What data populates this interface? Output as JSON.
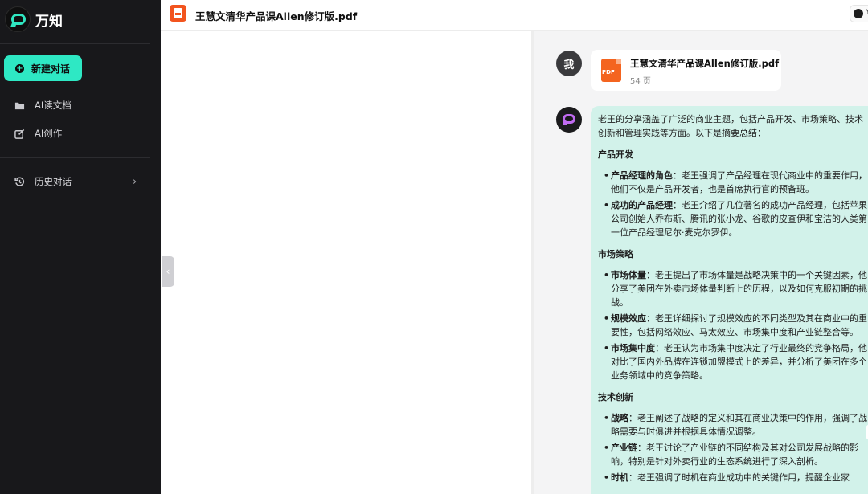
{
  "app": {
    "name": "万知"
  },
  "sidebar": {
    "new_chat_label": "新建对话",
    "items": [
      {
        "label": "AI读文档",
        "icon": "folder-icon"
      },
      {
        "label": "AI创作",
        "icon": "edit-icon"
      }
    ],
    "history_label": "历史对话"
  },
  "header": {
    "doc_title": "王慧文清华产品课Allen修订版.pdf",
    "chip_text": "Y"
  },
  "chat": {
    "user_avatar": "我",
    "file": {
      "name": "王慧文清华产品课Allen修订版.pdf",
      "pages": "54 页",
      "badge": "PDF"
    },
    "answer": {
      "intro": "老王的分享涵盖了广泛的商业主题，包括产品开发、市场策略、技术创新和管理实践等方面。以下是摘要总结：",
      "sections": [
        {
          "title": "产品开发",
          "items": [
            {
              "term": "产品经理的角色",
              "text": "：老王强调了产品经理在现代商业中的重要作用，他们不仅是产品开发者，也是首席执行官的预备班。"
            },
            {
              "term": "成功的产品经理",
              "text": "：老王介绍了几位著名的成功产品经理，包括苹果公司创始人乔布斯、腾讯的张小龙、谷歌的皮查伊和宝洁的人类第一位产品经理尼尔·麦克尔罗伊。"
            }
          ]
        },
        {
          "title": "市场策略",
          "items": [
            {
              "term": "市场体量",
              "text": "：老王提出了市场体量是战略决策中的一个关键因素，他分享了美团在外卖市场体量判断上的历程，以及如何克服初期的挑战。"
            },
            {
              "term": "规模效应",
              "text": "：老王详细探讨了规模效应的不同类型及其在商业中的重要性，包括网络效应、马太效应、市场集中度和产业链整合等。"
            },
            {
              "term": "市场集中度",
              "text": "：老王认为市场集中度决定了行业最终的竞争格局，他对比了国内外品牌在连锁加盟模式上的差异，并分析了美团在多个业务领域中的竞争策略。"
            }
          ]
        },
        {
          "title": "技术创新",
          "items": [
            {
              "term": "战略",
              "text": "：老王阐述了战略的定义和其在商业决策中的作用，强调了战略需要与时俱进并根据具体情况调整。"
            },
            {
              "term": "产业链",
              "text": "：老王讨论了产业链的不同结构及其对公司发展战略的影响，特别是针对外卖行业的生态系统进行了深入剖析。"
            },
            {
              "term": "时机",
              "text": "：老王强调了时机在商业成功中的关键作用，提醒企业家"
            }
          ]
        }
      ]
    }
  },
  "colors": {
    "accent": "#2ee8c4",
    "sidebar_bg": "#18181b",
    "answer_bg": "#d2f2ea",
    "pdf": "#f2541e"
  }
}
